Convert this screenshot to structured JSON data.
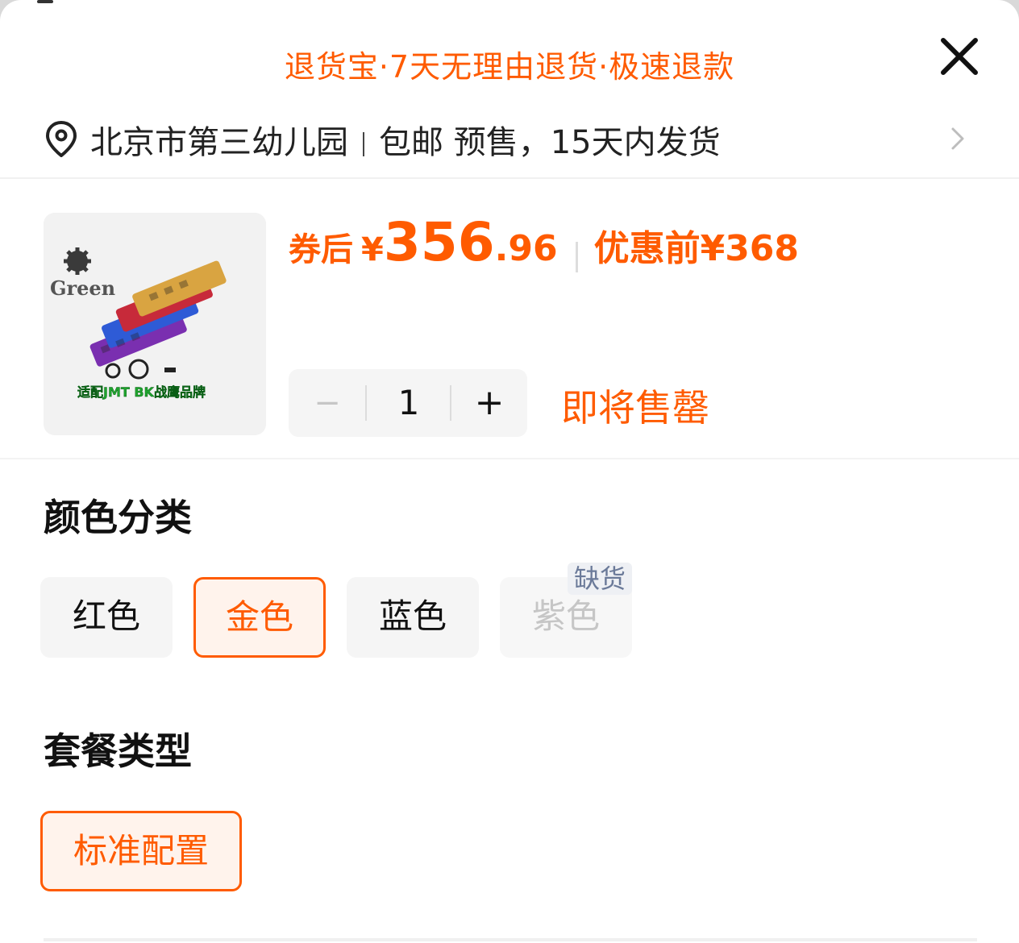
{
  "banner": {
    "text": "退货宝·7天无理由退货·极速退款"
  },
  "address": {
    "location": "北京市第三幼儿园",
    "shipping": "包邮 预售，15天内发货",
    "icon": "location-pin-icon"
  },
  "product": {
    "image_label": "适配JMT BK战鹰品牌",
    "image_logo": "Green",
    "coupon_label": "券后",
    "currency": "¥",
    "price_int": "356",
    "price_dec": ".96",
    "before_label": "优惠前",
    "before_price": "¥368",
    "quantity": "1",
    "minus": "−",
    "plus": "+",
    "stock_note": "即将售罄"
  },
  "color_section": {
    "title": "颜色分类",
    "options": [
      {
        "label": "红色",
        "state": "normal"
      },
      {
        "label": "金色",
        "state": "selected"
      },
      {
        "label": "蓝色",
        "state": "normal"
      },
      {
        "label": "紫色",
        "state": "out_of_stock",
        "badge": "缺货"
      }
    ]
  },
  "package_section": {
    "title": "套餐类型",
    "options": [
      {
        "label": "标准配置",
        "state": "selected"
      }
    ]
  },
  "colors": {
    "accent": "#ff5b00",
    "chip_bg": "#f5f5f5",
    "selected_bg": "#fff3ec"
  }
}
